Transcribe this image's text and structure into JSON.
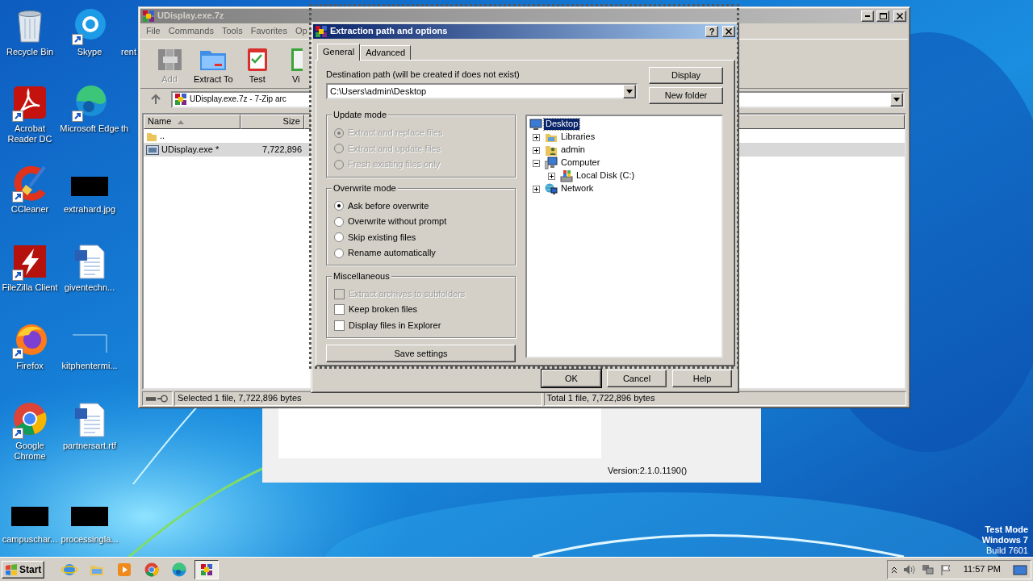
{
  "desktop": {
    "icon_rows": [
      [
        {
          "label": "Recycle Bin",
          "kind": "recycle-bin",
          "shortcut": false
        },
        {
          "label": "Skype",
          "kind": "skype",
          "shortcut": true
        },
        {
          "label": "rent",
          "kind": "covered",
          "shortcut": false
        }
      ],
      [
        {
          "label": "Acrobat Reader DC",
          "kind": "acrobat",
          "shortcut": true
        },
        {
          "label": "Microsoft Edge",
          "kind": "edge",
          "shortcut": true
        },
        {
          "label": "th",
          "kind": "covered",
          "shortcut": false
        }
      ],
      [
        {
          "label": "CCleaner",
          "kind": "ccleaner",
          "shortcut": true
        },
        {
          "label": "extrahard.jpg",
          "kind": "dark-thumbnail",
          "shortcut": false
        }
      ],
      [
        {
          "label": "FileZilla Client",
          "kind": "filezilla",
          "shortcut": true
        },
        {
          "label": "giventechn...",
          "kind": "document",
          "shortcut": false
        }
      ],
      [
        {
          "label": "Firefox",
          "kind": "firefox",
          "shortcut": true
        },
        {
          "label": "kitphentermi...",
          "kind": "blank-thumbnail",
          "shortcut": false
        }
      ],
      [
        {
          "label": "Google Chrome",
          "kind": "chrome",
          "shortcut": true
        },
        {
          "label": "partnersart.rtf",
          "kind": "document",
          "shortcut": false
        }
      ],
      [
        {
          "label": "campuschar...",
          "kind": "dark-thumbnail",
          "shortcut": false
        },
        {
          "label": "processingla...",
          "kind": "dark-thumbnail",
          "shortcut": false
        }
      ]
    ]
  },
  "background_window": {
    "version": "Version:2.1.0.1190()"
  },
  "archive_window": {
    "title": "UDisplay.exe.7z",
    "menu": [
      "File",
      "Commands",
      "Tools",
      "Favorites",
      "Op"
    ],
    "toolbar": [
      {
        "label": "Add",
        "kind": "add",
        "disabled": true
      },
      {
        "label": "Extract To",
        "kind": "extract",
        "disabled": false
      },
      {
        "label": "Test",
        "kind": "test",
        "disabled": false
      },
      {
        "label": "Vi",
        "kind": "view",
        "disabled": false
      }
    ],
    "address": "UDisplay.exe.7z - 7-Zip arc",
    "columns": [
      {
        "label": "Name",
        "sorted": true
      },
      {
        "label": "Size",
        "sorted": false
      }
    ],
    "rows": [
      {
        "name": "..",
        "kind": "folder",
        "selected": false
      },
      {
        "name": "UDisplay.exe *",
        "size": "7,722,896",
        "kind": "file",
        "selected": true
      }
    ],
    "status": [
      "Selected 1 file, 7,722,896 bytes",
      "Total 1 file, 7,722,896 bytes"
    ]
  },
  "dialog": {
    "title": "Extraction path and options",
    "help": "?",
    "tabs": [
      {
        "label": "General",
        "selected": true
      },
      {
        "label": "Advanced",
        "selected": false
      }
    ],
    "destination_label": "Destination path (will be created if does not exist)",
    "destination": "C:\\Users\\admin\\Desktop",
    "side_buttons": [
      "Display",
      "New folder"
    ],
    "groups": [
      {
        "title": "Update mode",
        "kind": "radio",
        "options": [
          {
            "label": "Extract and replace files",
            "selected": true,
            "disabled": true
          },
          {
            "label": "Extract and update files",
            "selected": false,
            "disabled": true
          },
          {
            "label": "Fresh existing files only",
            "selected": false,
            "disabled": true
          }
        ]
      },
      {
        "title": "Overwrite mode",
        "kind": "radio",
        "options": [
          {
            "label": "Ask before overwrite",
            "selected": true,
            "disabled": false
          },
          {
            "label": "Overwrite without prompt",
            "selected": false,
            "disabled": false
          },
          {
            "label": "Skip existing files",
            "selected": false,
            "disabled": false
          },
          {
            "label": "Rename automatically",
            "selected": false,
            "disabled": false
          }
        ]
      },
      {
        "title": "Miscellaneous",
        "kind": "checkbox",
        "options": [
          {
            "label": "Extract archives to subfolders",
            "checked": false,
            "disabled": true
          },
          {
            "label": "Keep broken files",
            "checked": false,
            "disabled": false
          },
          {
            "label": "Display files in Explorer",
            "checked": false,
            "disabled": false
          }
        ]
      }
    ],
    "save_button": "Save settings",
    "tree": [
      {
        "label": "Desktop",
        "kind": "desktop",
        "selected": true,
        "children": [
          {
            "label": "Libraries",
            "kind": "libraries",
            "selected": false,
            "expanded": false
          },
          {
            "label": "admin",
            "kind": "user",
            "selected": false,
            "expanded": false
          },
          {
            "label": "Computer",
            "kind": "computer",
            "selected": false,
            "expanded": true,
            "children": [
              {
                "label": "Local Disk (C:)",
                "kind": "disk",
                "selected": false,
                "expanded": false
              }
            ]
          },
          {
            "label": "Network",
            "kind": "network",
            "selected": false,
            "expanded": false
          }
        ]
      }
    ],
    "buttons": [
      {
        "label": "OK",
        "default": true
      },
      {
        "label": "Cancel",
        "default": false
      },
      {
        "label": "Help",
        "default": false
      }
    ]
  },
  "taskbar": {
    "start": "Start",
    "apps": [
      {
        "kind": "ie",
        "active": false
      },
      {
        "kind": "folder",
        "active": false
      },
      {
        "kind": "media",
        "active": false
      },
      {
        "kind": "chrome",
        "active": false
      },
      {
        "kind": "edge",
        "active": false
      },
      {
        "kind": "archiver",
        "active": true
      }
    ],
    "clock": "11:57 PM"
  },
  "os_notice": [
    "Test Mode",
    "Windows 7",
    "Build 7601"
  ]
}
